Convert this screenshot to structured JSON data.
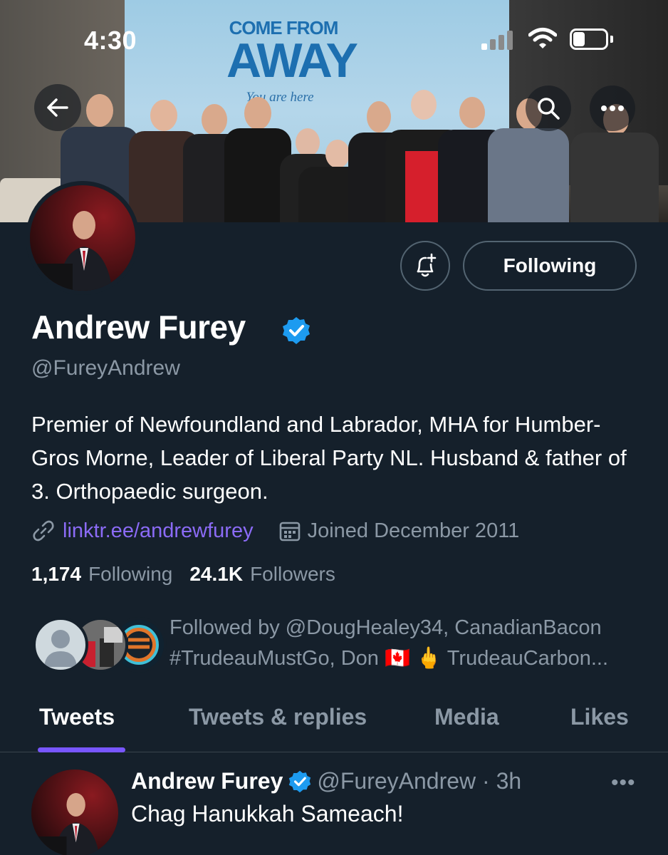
{
  "status_bar": {
    "time": "4:30"
  },
  "banner": {
    "sign_line1": "COME FROM",
    "sign_line2": "AWAY",
    "sign_line3": "You are here"
  },
  "header_actions": {
    "back_icon": "arrow-left-icon",
    "search_icon": "search-icon",
    "more_icon": "more-horizontal-icon"
  },
  "profile": {
    "name": "Andrew Furey",
    "handle": "@FureyAndrew",
    "verified": true,
    "verified_color": "#1d9bf0",
    "bio": "Premier of Newfoundland and Labrador, MHA for Humber-Gros Morne, Leader of Liberal Party NL. Husband & father of 3. Orthopaedic surgeon.",
    "link": "linktr.ee/andrewfurey",
    "joined": "Joined December 2011",
    "following_count": "1,174",
    "following_label": "Following",
    "followers_count": "24.1K",
    "followers_label": "Followers",
    "following_button": "Following",
    "followed_by_line1": "Followed by @DougHealey34, CanadianBacon",
    "followed_by_line2": "#TrudeauMustGo, Don 🇨🇦 🖕 TrudeauCarbon..."
  },
  "tabs": [
    {
      "label": "Tweets",
      "active": true
    },
    {
      "label": "Tweets & replies",
      "active": false
    },
    {
      "label": "Media",
      "active": false
    },
    {
      "label": "Likes",
      "active": false
    }
  ],
  "tweet": {
    "name": "Andrew Furey",
    "handle_time": "@FureyAndrew · 3h",
    "text": "Chag Hanukkah Sameach!",
    "more": "•••"
  },
  "colors": {
    "background": "#15202b",
    "accent": "#7856ff",
    "link": "#8b6bf6",
    "muted": "#8b98a5",
    "border": "#536471"
  }
}
